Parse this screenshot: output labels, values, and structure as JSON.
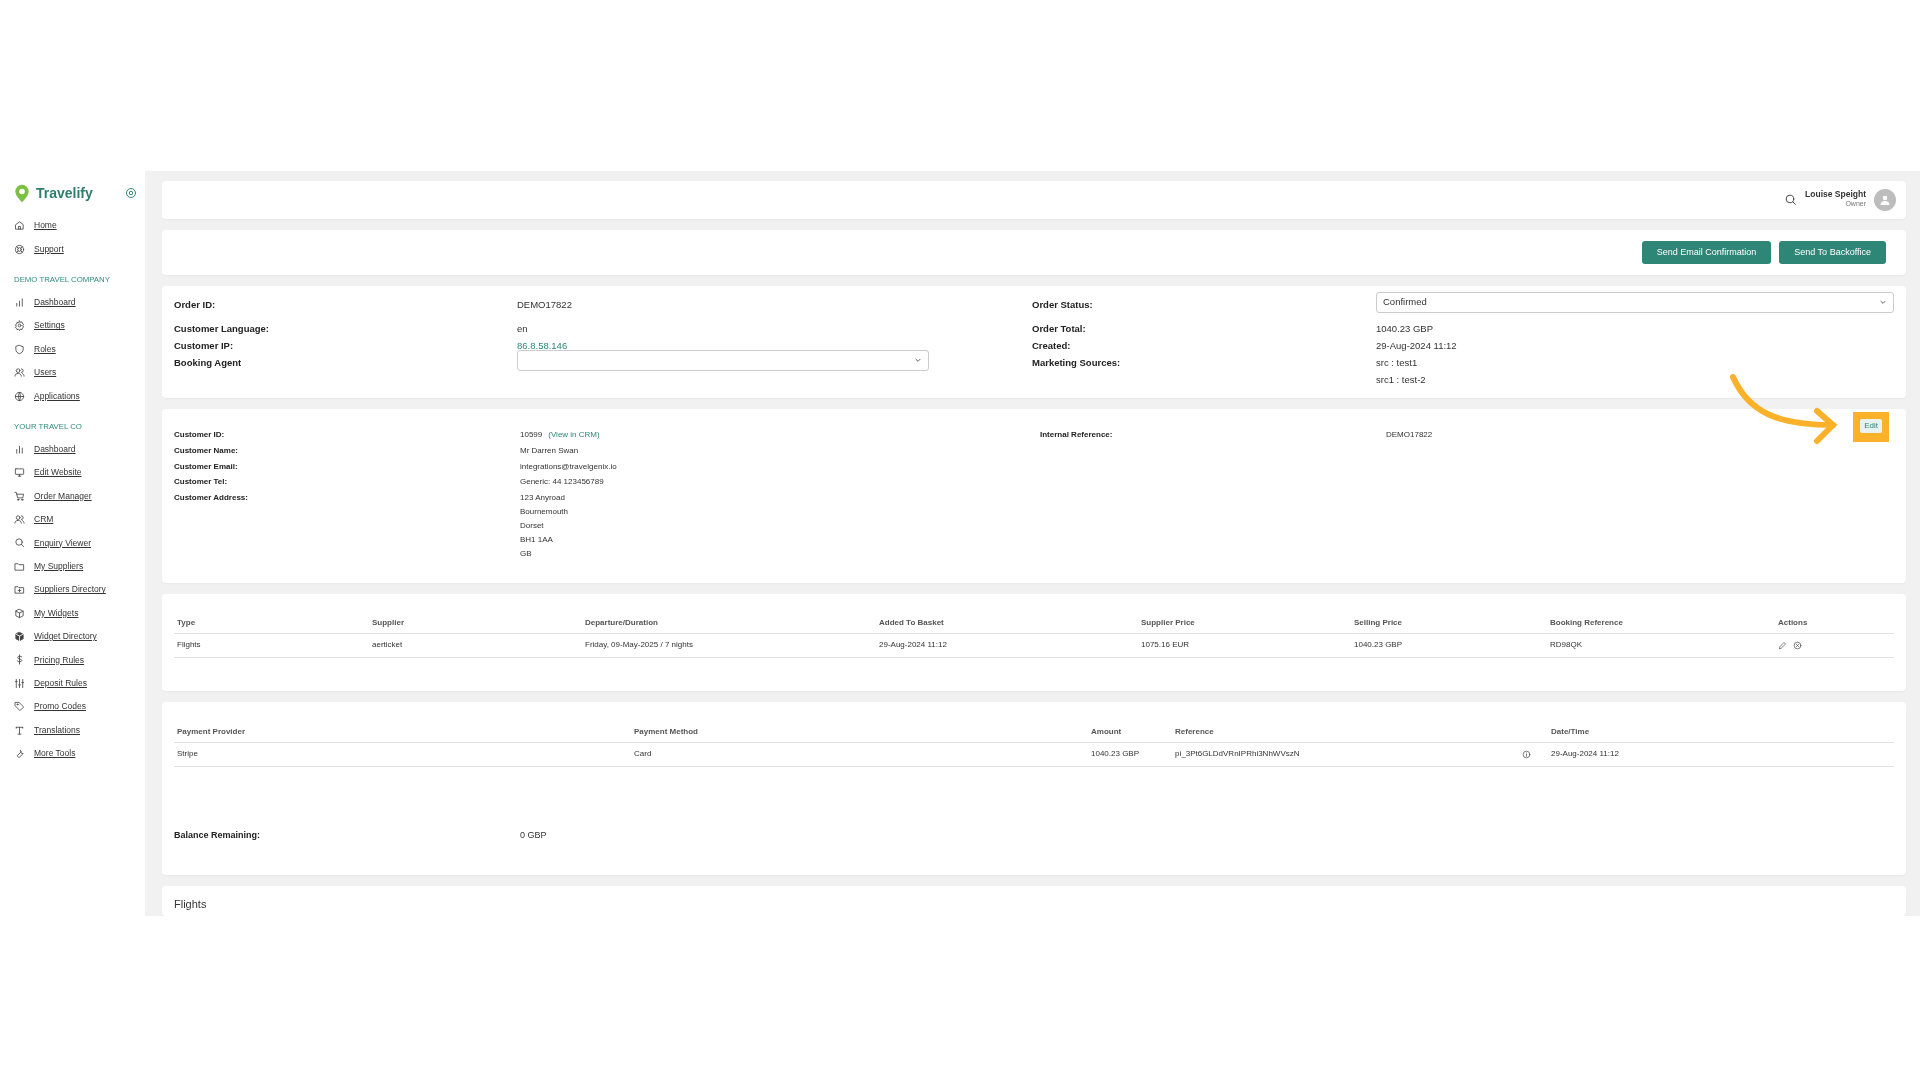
{
  "brand": {
    "name": "Travelify"
  },
  "sidebar": {
    "items": [
      {
        "label": "Home",
        "selected": false
      },
      {
        "label": "Support",
        "selected": false
      }
    ],
    "sections": [
      {
        "title": "DEMO TRAVEL COMPANY",
        "items": [
          {
            "label": "Dashboard",
            "selected": false
          },
          {
            "label": "Settings",
            "selected": false
          },
          {
            "label": "Roles",
            "selected": false
          },
          {
            "label": "Users",
            "selected": false
          },
          {
            "label": "Applications",
            "selected": false
          }
        ]
      },
      {
        "title": "YOUR TRAVEL CO",
        "items": [
          {
            "label": "Dashboard",
            "selected": false
          },
          {
            "label": "Edit Website",
            "selected": false
          },
          {
            "label": "Order Manager",
            "selected": false
          },
          {
            "label": "CRM",
            "selected": false
          },
          {
            "label": "Enquiry Viewer",
            "selected": false
          },
          {
            "label": "My Suppliers",
            "selected": false
          },
          {
            "label": "Suppliers Directory",
            "selected": false
          },
          {
            "label": "My Widgets",
            "selected": false
          },
          {
            "label": "Widget Directory",
            "selected": false
          },
          {
            "label": "Pricing Rules",
            "selected": false
          },
          {
            "label": "Deposit Rules",
            "selected": false
          },
          {
            "label": "Promo Codes",
            "selected": false
          },
          {
            "label": "Translations",
            "selected": false
          },
          {
            "label": "More Tools",
            "selected": false
          }
        ]
      }
    ]
  },
  "header": {
    "user_name": "Louise Speight",
    "user_role": "Owner"
  },
  "actions": [
    "Send Email Confirmation",
    "Send To Backoffice"
  ],
  "order": {
    "left": [
      {
        "label": "Order ID:",
        "kind": "text",
        "value": "DEMO17822"
      },
      {
        "label": "Customer Language:",
        "kind": "text",
        "value": "en"
      },
      {
        "label": "Customer IP:",
        "kind": "link",
        "value": "86.8.58.146"
      },
      {
        "label": "Booking Agent",
        "kind": "select"
      }
    ],
    "right": [
      {
        "label": "Order Status:",
        "kind": "select",
        "value": "Confirmed"
      },
      {
        "label": "Order Total:",
        "kind": "text",
        "value": "1040.23 GBP"
      },
      {
        "label": "Created:",
        "kind": "text",
        "value": "29-Aug-2024 11:12"
      },
      {
        "label": "Marketing Sources:",
        "kind": "lines",
        "lines": [
          "src : test1",
          "src1 : test-2"
        ]
      }
    ]
  },
  "customer": {
    "rows": [
      {
        "label": "Customer ID:",
        "value": "10599",
        "link": "(View in CRM)"
      },
      {
        "label": "Customer Name:",
        "value": "Mr Darren Swan"
      },
      {
        "label": "Customer Email:",
        "value": "integrations@travelgenix.io"
      },
      {
        "label": "Customer Tel:",
        "value": "Generic: 44 123456789"
      },
      {
        "label": "Customer Address:",
        "lines": [
          "123 Anyroad",
          "Bournemouth",
          "Dorset",
          "BH1 1AA",
          "GB"
        ]
      }
    ],
    "internal_reference": {
      "label": "Internal Reference:",
      "value": "DEMO17822"
    },
    "edit_button": {
      "label": "Edit",
      "highlighted": true
    }
  },
  "items": {
    "columns": [
      "Type",
      "Supplier",
      "Departure/Duration",
      "Added To Basket",
      "Supplier Price",
      "Selling Price",
      "Booking Reference",
      "Actions"
    ],
    "rows": [
      {
        "cells": [
          "Flights",
          "aerticket",
          "Friday, 09-May-2025 / 7 nights",
          "29-Aug-2024 11:12",
          "1075.16 EUR",
          "1040.23 GBP",
          "RD98QK"
        ]
      }
    ]
  },
  "payments": {
    "columns": [
      "Payment Provider",
      "Payment Method",
      "Amount",
      "Reference",
      "Date/Time"
    ],
    "rows": [
      {
        "cells": [
          "Stripe",
          "Card",
          "1040.23 GBP",
          "pi_3Pt6GLDdVRnIPRhi3NhWVszN",
          "29-Aug-2024 11:12"
        ]
      }
    ],
    "balance": {
      "label": "Balance Remaining:",
      "value": "0 GBP"
    }
  },
  "flights": {
    "title": "Flights"
  }
}
